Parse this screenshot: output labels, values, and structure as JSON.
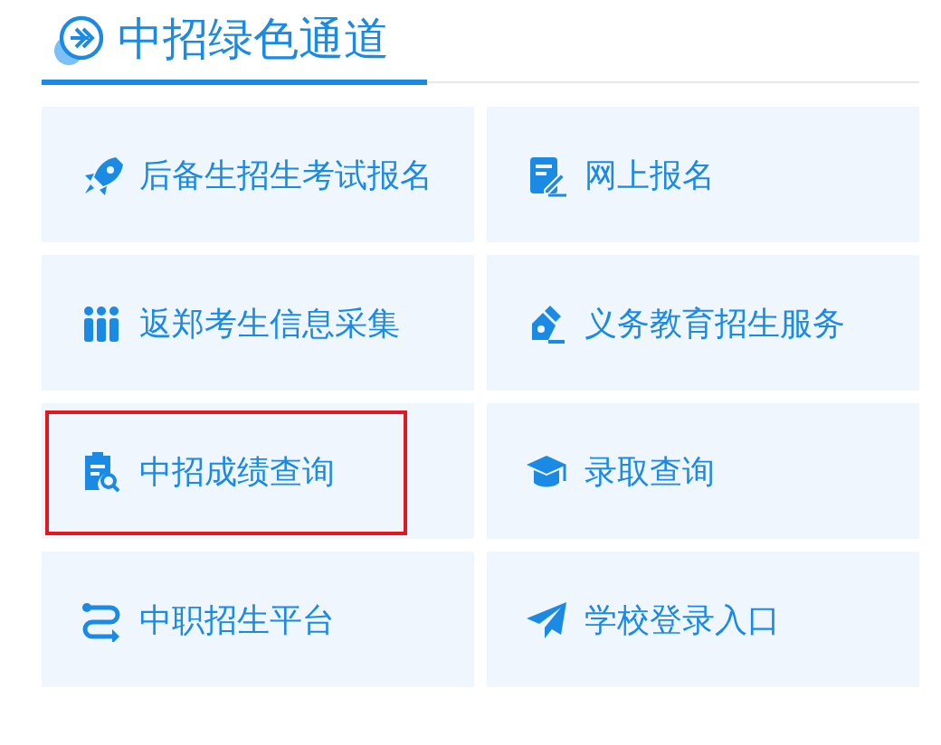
{
  "section": {
    "title": "中招绿色通道"
  },
  "links": [
    {
      "label": "后备生招生考试报名",
      "highlighted": false
    },
    {
      "label": "网上报名",
      "highlighted": false
    },
    {
      "label": "返郑考生信息采集",
      "highlighted": false
    },
    {
      "label": "义务教育招生服务",
      "highlighted": false
    },
    {
      "label": "中招成绩查询",
      "highlighted": true
    },
    {
      "label": "录取查询",
      "highlighted": false
    },
    {
      "label": "中职招生平台",
      "highlighted": false
    },
    {
      "label": "学校登录入口",
      "highlighted": false
    }
  ]
}
